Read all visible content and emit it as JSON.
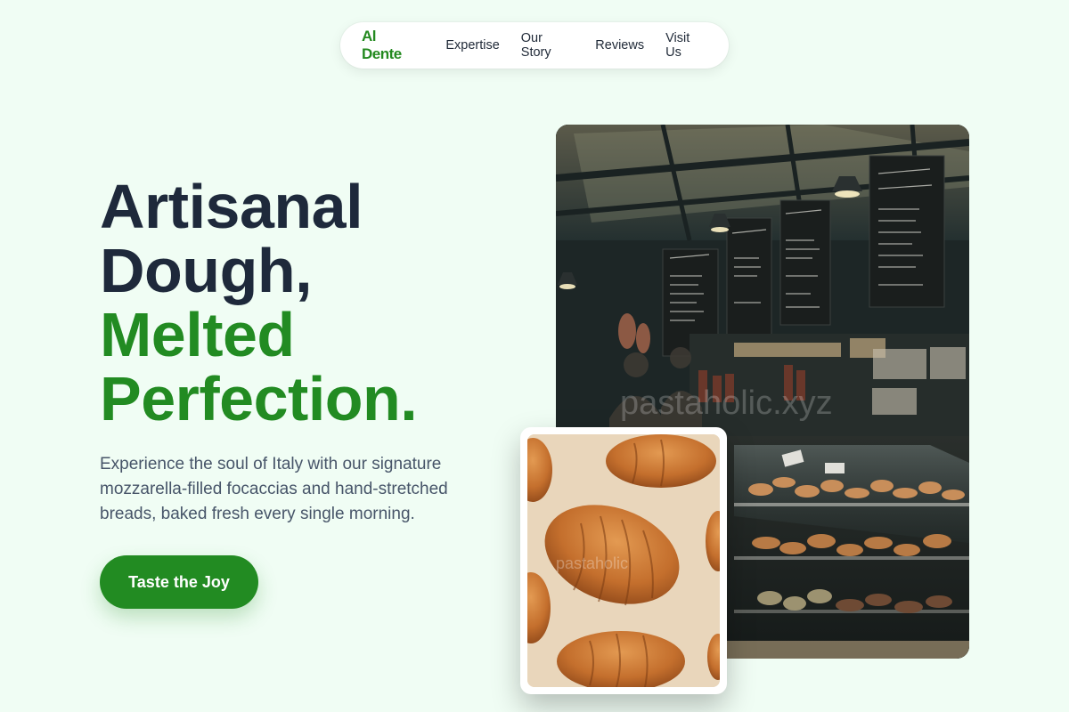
{
  "nav": {
    "brand": "Al Dente",
    "links": [
      "Expertise",
      "Our Story",
      "Reviews",
      "Visit Us"
    ]
  },
  "hero": {
    "title_line1": "Artisanal",
    "title_line2": "Dough,",
    "title_line3": "Melted",
    "title_line4": "Perfection.",
    "subtitle": "Experience the soul of Italy with our signature mozzarella-filled focaccias and hand-stretched breads, baked fresh every single morning.",
    "cta_label": "Taste the Joy"
  },
  "images": {
    "shop_watermark": "pastaholic.xyz",
    "croissant_watermark": "pastaholic"
  },
  "colors": {
    "background": "#f0fdf4",
    "brand_green": "#228b22",
    "heading_dark": "#1e293b",
    "body_text": "#475569"
  }
}
